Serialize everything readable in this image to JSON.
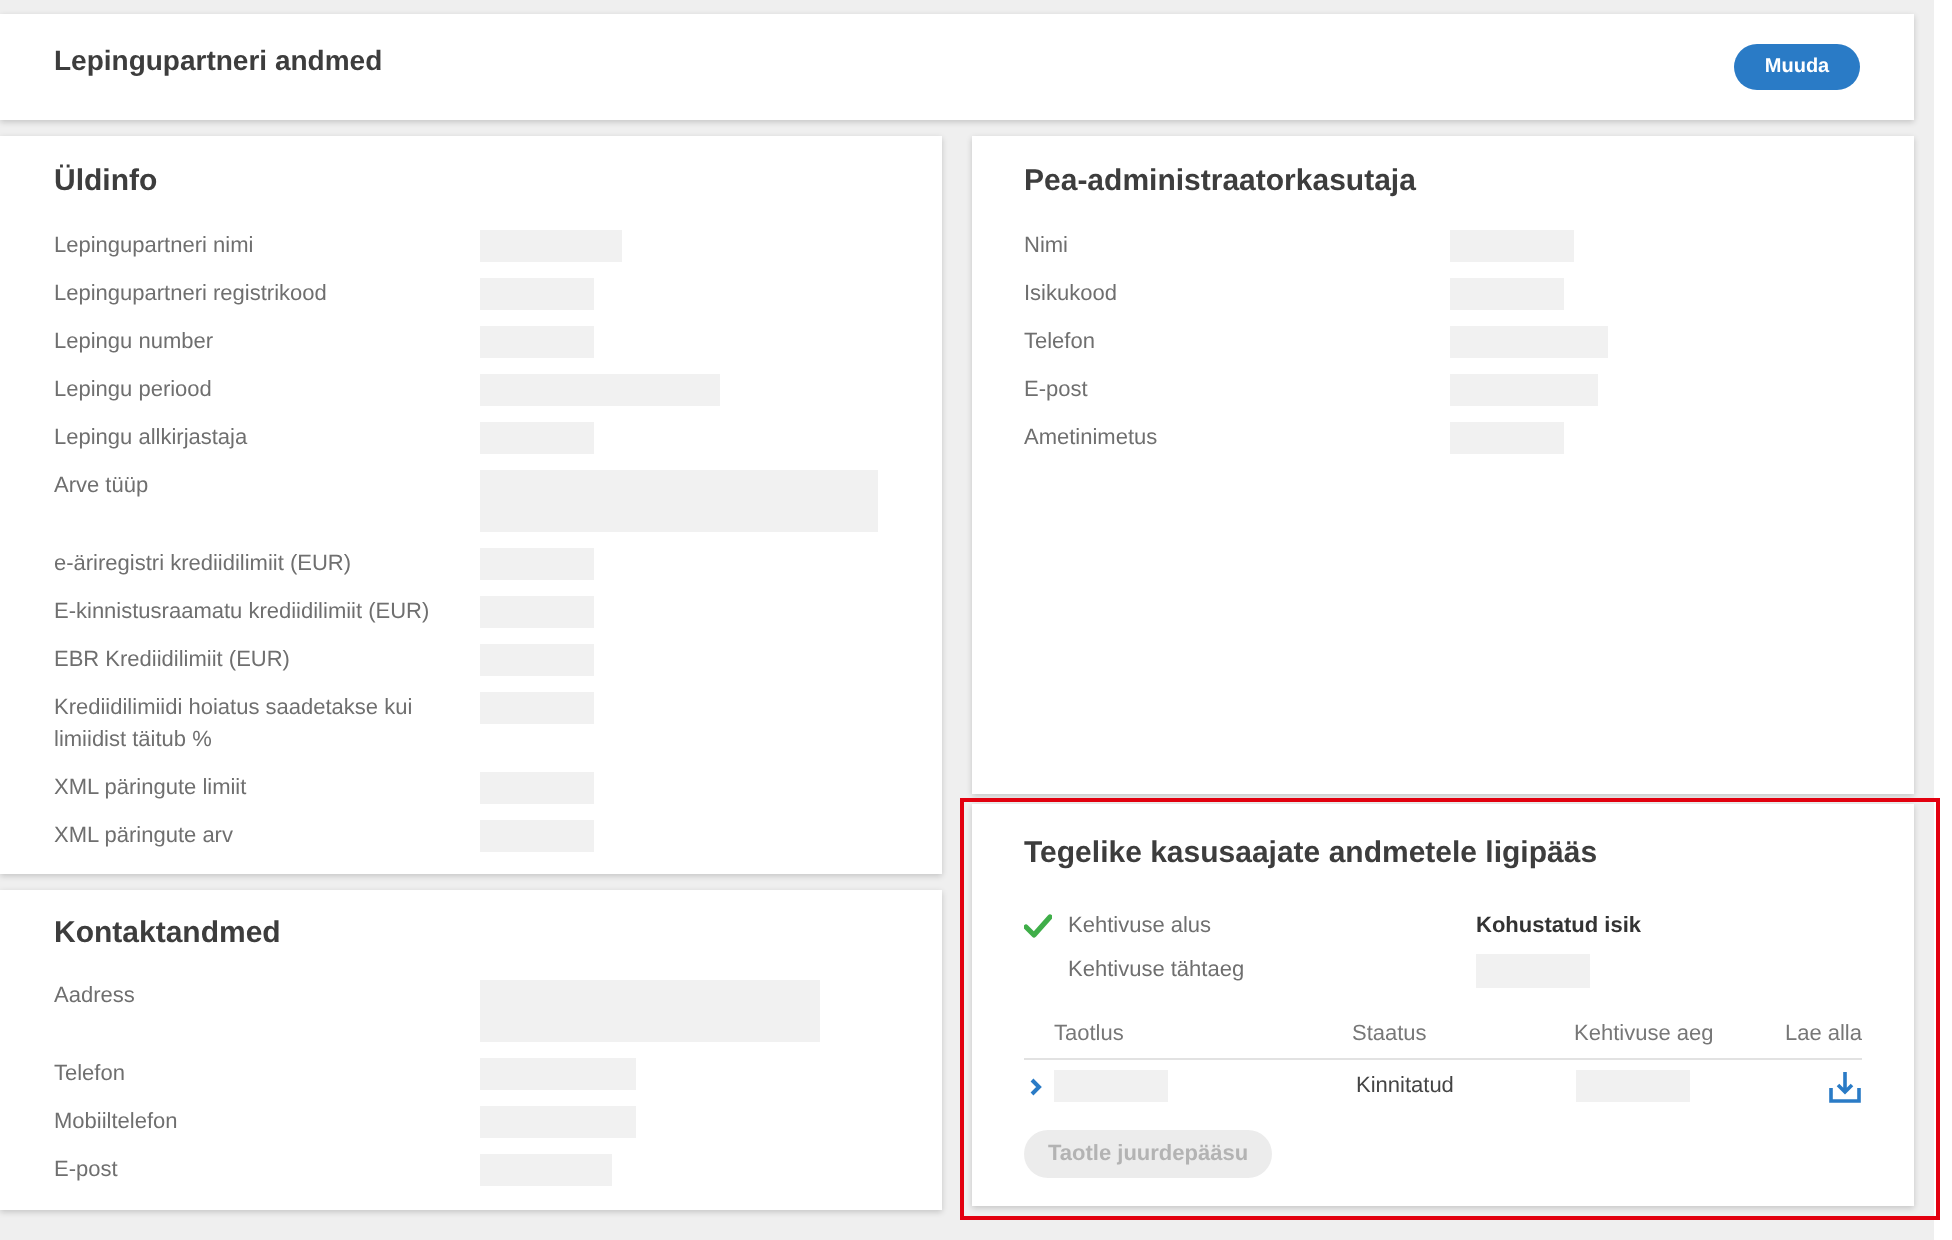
{
  "header": {
    "title": "Lepingupartneri andmed",
    "edit_button": "Muuda"
  },
  "general_info": {
    "title": "Üldinfo",
    "fields": [
      {
        "label": "Lepingupartneri nimi"
      },
      {
        "label": "Lepingupartneri registrikood"
      },
      {
        "label": "Lepingu number"
      },
      {
        "label": "Lepingu periood"
      },
      {
        "label": "Lepingu allkirjastaja"
      },
      {
        "label": "Arve tüüp"
      },
      {
        "label": "e-äriregistri krediidilimiit (EUR)"
      },
      {
        "label": "E-kinnistusraamatu krediidilimiit (EUR)"
      },
      {
        "label": "EBR Krediidilimiit (EUR)"
      },
      {
        "label": "Krediidilimiidi hoiatus saadetakse kui limiidist täitub %"
      },
      {
        "label": "XML päringute limiit"
      },
      {
        "label": "XML päringute arv"
      }
    ]
  },
  "contact": {
    "title": "Kontaktandmed",
    "fields": [
      {
        "label": "Aadress"
      },
      {
        "label": "Telefon"
      },
      {
        "label": "Mobiiltelefon"
      },
      {
        "label": "E-post"
      }
    ]
  },
  "main_admin": {
    "title": "Pea-administraatorkasutaja",
    "fields": [
      {
        "label": "Nimi"
      },
      {
        "label": "Isikukood"
      },
      {
        "label": "Telefon"
      },
      {
        "label": "E-post"
      },
      {
        "label": "Ametinimetus"
      }
    ]
  },
  "beneficial_access": {
    "highlighted": true,
    "title": "Tegelike kasusaajate andmetele ligipääs",
    "validity": [
      {
        "label": "Kehtivuse alus",
        "confirmed": true,
        "value": "Kohustatud isik"
      },
      {
        "label": "Kehtivuse tähtaeg",
        "confirmed": false
      }
    ],
    "table": {
      "columns": [
        "Taotlus",
        "Staatus",
        "Kehtivuse aeg",
        "Lae alla"
      ],
      "rows": [
        {
          "expanded": false,
          "status": "Kinnitatud"
        }
      ]
    },
    "request_button": {
      "label": "Taotle juurdepääsu",
      "disabled": true
    }
  }
}
